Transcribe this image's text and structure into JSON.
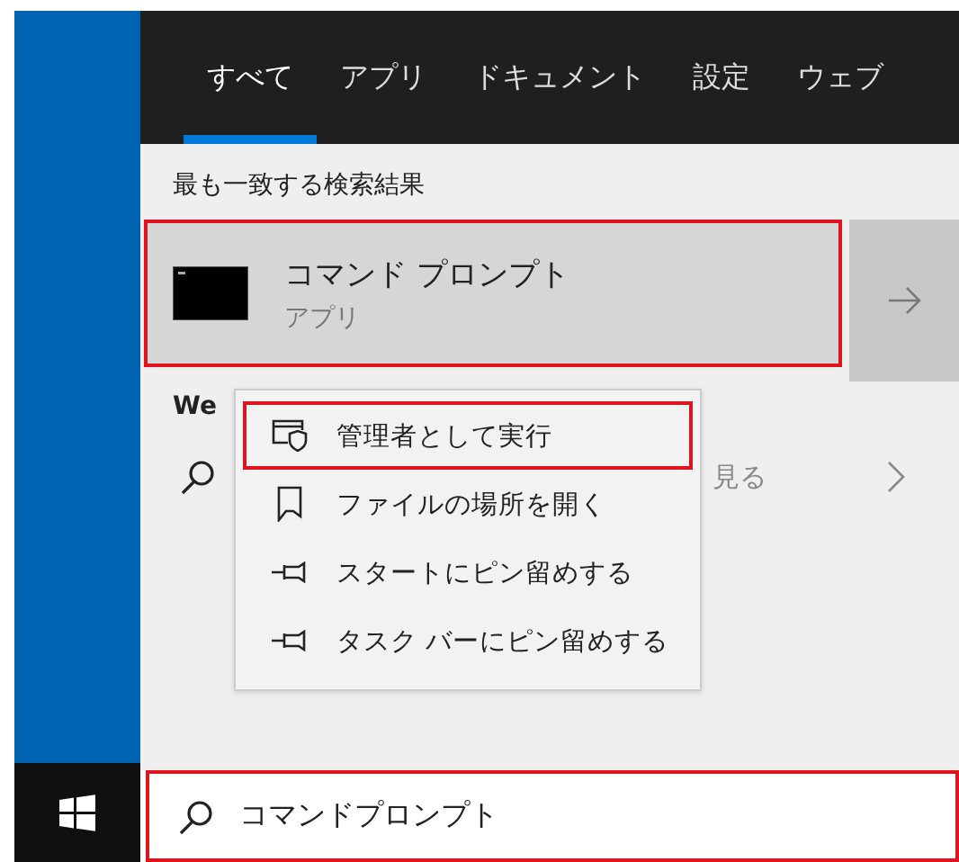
{
  "tabs": [
    {
      "label": "すべて",
      "selected": true
    },
    {
      "label": "アプリ",
      "selected": false
    },
    {
      "label": "ドキュメント",
      "selected": false
    },
    {
      "label": "設定",
      "selected": false
    },
    {
      "label": "ウェブ",
      "selected": false
    }
  ],
  "best_match": {
    "heading": "最も一致する検索結果",
    "title": "コマンド プロンプト",
    "subtitle": "アプリ",
    "highlighted": true
  },
  "web": {
    "heading": "We",
    "result": "見る"
  },
  "context_menu": [
    {
      "label": "管理者として実行",
      "kind": "admin",
      "highlighted": true
    },
    {
      "label": "ファイルの場所を開く",
      "kind": "folder",
      "highlighted": false
    },
    {
      "label": "スタートにピン留めする",
      "kind": "pin",
      "highlighted": false
    },
    {
      "label": "タスク バーにピン留めする",
      "kind": "pin",
      "highlighted": false
    }
  ],
  "search_box": {
    "value": "コマンドプロンプト",
    "highlighted": true
  }
}
